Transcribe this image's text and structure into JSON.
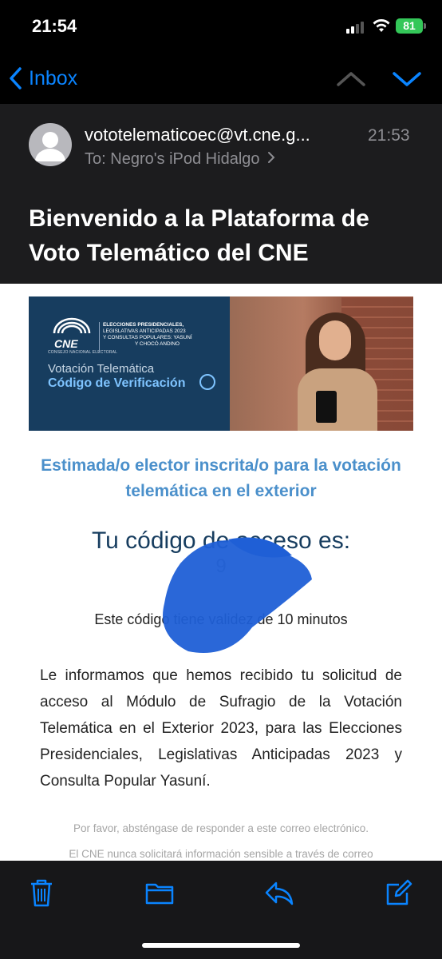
{
  "status_bar": {
    "time": "21:54",
    "battery": "81"
  },
  "nav": {
    "back_label": "Inbox",
    "back_icon": "chevron-left-icon",
    "prev_icon": "chevron-up-icon",
    "next_icon": "chevron-down-icon"
  },
  "mail": {
    "sender": "vototelematicoec@vt.cne.g...",
    "time": "21:53",
    "to_prefix": "To:",
    "recipient": "Negro's iPod Hidalgo",
    "subject": "Bienvenido a la Plataforma de Voto Telemático del CNE"
  },
  "banner": {
    "logo_text": "CNE",
    "logo_sub": "CONSEJO NACIONAL ELECTORAL",
    "election_line1": "ELECCIONES PRESIDENCIALES,",
    "election_line2": "LEGISLATIVAS ANTICIPADAS 2023",
    "election_line3": "Y CONSULTAS POPULARES: YASUNÍ",
    "election_line4": "Y CHOCÓ ANDINO",
    "line1": "Votación Telemática",
    "line2": "Código de Verificación"
  },
  "body": {
    "greeting": "Estimada/o elector inscrita/o para la votación telemática en el exterior",
    "code_title": "Tu código de acceso es:",
    "code_value": "9",
    "validity": "Este código tiene validez de 10 minutos",
    "info": "Le informamos que hemos recibido tu solicitud de acceso al Módulo de Sufragio de la Votación Telemática en el Exterior 2023, para las Elecciones Presidenciales, Legislativas Anticipadas 2023 y Consulta Popular Yasuní.",
    "footer1": "Por favor, absténgase de responder a este correo electrónico.",
    "footer2": "El CNE nunca solicitará información sensible a través de correo"
  },
  "toolbar": {
    "icons": [
      "trash-icon",
      "folder-icon",
      "reply-icon",
      "compose-icon"
    ]
  },
  "colors": {
    "accent": "#0a84ff",
    "banner_bg": "#173d5f",
    "greeting": "#4b90cb"
  }
}
